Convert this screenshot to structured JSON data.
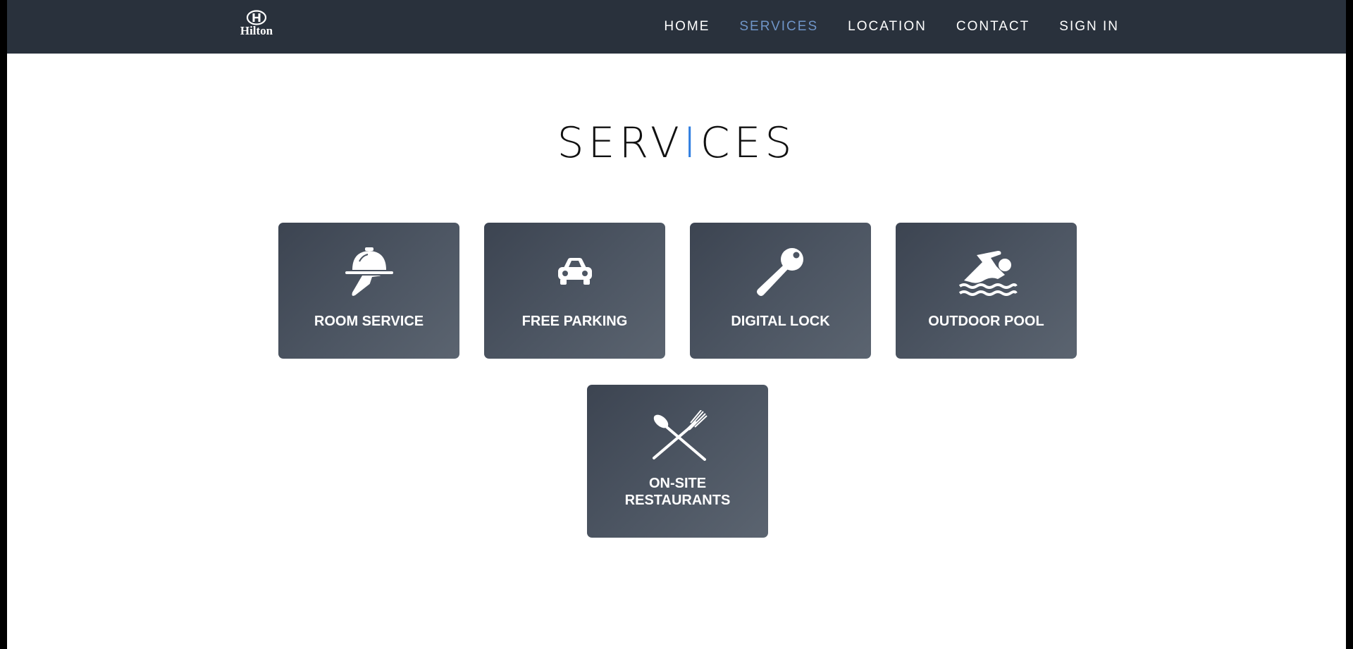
{
  "brand": {
    "logo_text": "Hilton",
    "logo_icon": "hilton-crest-icon"
  },
  "nav": {
    "items": [
      {
        "label": "HOME",
        "active": false
      },
      {
        "label": "SERVICES",
        "active": true
      },
      {
        "label": "LOCATION",
        "active": false
      },
      {
        "label": "CONTACT",
        "active": false
      },
      {
        "label": "SIGN IN",
        "active": false
      }
    ]
  },
  "heading": {
    "before": "SERV",
    "accent": "I",
    "after": "CES"
  },
  "services": [
    {
      "label": "ROOM SERVICE",
      "icon": "room-service-icon"
    },
    {
      "label": "FREE PARKING",
      "icon": "car-icon"
    },
    {
      "label": "DIGITAL LOCK",
      "icon": "key-icon"
    },
    {
      "label": "OUTDOOR POOL",
      "icon": "swimmer-icon"
    },
    {
      "label_line1": "ON-SITE",
      "label_line2": "RESTAURANTS",
      "icon": "spoon-fork-icon"
    }
  ],
  "colors": {
    "navbar": "#29313c",
    "nav_active": "#6f95c8",
    "accent": "#2f7ee0",
    "card": "#4d5663"
  }
}
